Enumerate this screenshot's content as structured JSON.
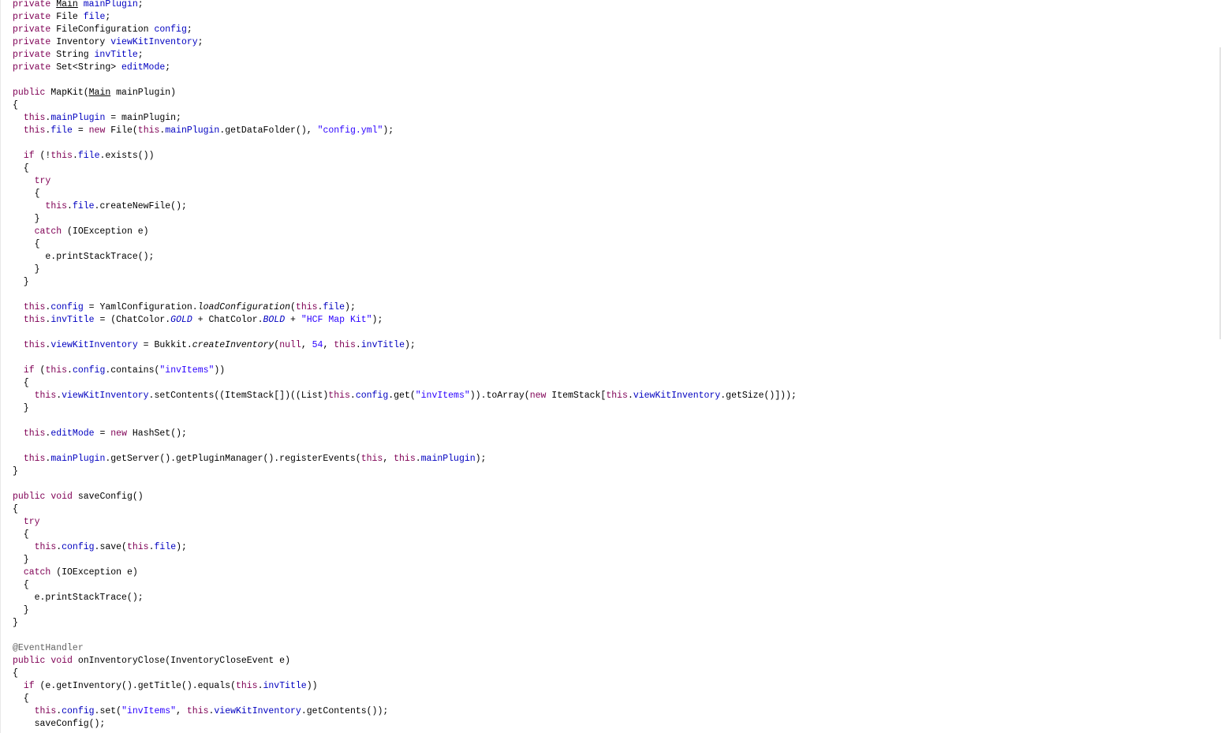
{
  "editor": {
    "language": "java",
    "colors": {
      "keyword": "#7f0055",
      "field": "#0000c0",
      "string": "#2a00ff",
      "number": "#2a00ff",
      "annotation": "#646464",
      "text": "#000000",
      "background": "#ffffff"
    },
    "lines": [
      [
        {
          "t": "kw",
          "v": "private"
        },
        {
          "v": " "
        },
        {
          "t": "ul",
          "v": "Main"
        },
        {
          "v": " "
        },
        {
          "t": "fld",
          "v": "mainPlugin"
        },
        {
          "v": ";"
        }
      ],
      [
        {
          "t": "kw",
          "v": "private"
        },
        {
          "v": " File "
        },
        {
          "t": "fld",
          "v": "file"
        },
        {
          "v": ";"
        }
      ],
      [
        {
          "t": "kw",
          "v": "private"
        },
        {
          "v": " FileConfiguration "
        },
        {
          "t": "fld",
          "v": "config"
        },
        {
          "v": ";"
        }
      ],
      [
        {
          "t": "kw",
          "v": "private"
        },
        {
          "v": " Inventory "
        },
        {
          "t": "fld",
          "v": "viewKitInventory"
        },
        {
          "v": ";"
        }
      ],
      [
        {
          "t": "kw",
          "v": "private"
        },
        {
          "v": " String "
        },
        {
          "t": "fld",
          "v": "invTitle"
        },
        {
          "v": ";"
        }
      ],
      [
        {
          "t": "kw",
          "v": "private"
        },
        {
          "v": " Set<String> "
        },
        {
          "t": "fld",
          "v": "editMode"
        },
        {
          "v": ";"
        }
      ],
      [],
      [
        {
          "t": "kw",
          "v": "public"
        },
        {
          "v": " MapKit("
        },
        {
          "t": "ul",
          "v": "Main"
        },
        {
          "v": " mainPlugin)"
        }
      ],
      [
        {
          "v": "{"
        }
      ],
      [
        {
          "v": "  "
        },
        {
          "t": "kw",
          "v": "this"
        },
        {
          "v": "."
        },
        {
          "t": "fld",
          "v": "mainPlugin"
        },
        {
          "v": " = mainPlugin;"
        }
      ],
      [
        {
          "v": "  "
        },
        {
          "t": "kw",
          "v": "this"
        },
        {
          "v": "."
        },
        {
          "t": "fld",
          "v": "file"
        },
        {
          "v": " = "
        },
        {
          "t": "kw",
          "v": "new"
        },
        {
          "v": " File("
        },
        {
          "t": "kw",
          "v": "this"
        },
        {
          "v": "."
        },
        {
          "t": "fld",
          "v": "mainPlugin"
        },
        {
          "v": ".getDataFolder(), "
        },
        {
          "t": "str",
          "v": "\"config.yml\""
        },
        {
          "v": ");"
        }
      ],
      [],
      [
        {
          "v": "  "
        },
        {
          "t": "kw",
          "v": "if"
        },
        {
          "v": " (!"
        },
        {
          "t": "kw",
          "v": "this"
        },
        {
          "v": "."
        },
        {
          "t": "fld",
          "v": "file"
        },
        {
          "v": ".exists())"
        }
      ],
      [
        {
          "v": "  {"
        }
      ],
      [
        {
          "v": "    "
        },
        {
          "t": "kw",
          "v": "try"
        }
      ],
      [
        {
          "v": "    {"
        }
      ],
      [
        {
          "v": "      "
        },
        {
          "t": "kw",
          "v": "this"
        },
        {
          "v": "."
        },
        {
          "t": "fld",
          "v": "file"
        },
        {
          "v": ".createNewFile();"
        }
      ],
      [
        {
          "v": "    }"
        }
      ],
      [
        {
          "v": "    "
        },
        {
          "t": "kw",
          "v": "catch"
        },
        {
          "v": " (IOException e)"
        }
      ],
      [
        {
          "v": "    {"
        }
      ],
      [
        {
          "v": "      e.printStackTrace();"
        }
      ],
      [
        {
          "v": "    }"
        }
      ],
      [
        {
          "v": "  }"
        }
      ],
      [],
      [
        {
          "v": "  "
        },
        {
          "t": "kw",
          "v": "this"
        },
        {
          "v": "."
        },
        {
          "t": "fld",
          "v": "config"
        },
        {
          "v": " = YamlConfiguration."
        },
        {
          "t": "it",
          "v": "loadConfiguration"
        },
        {
          "v": "("
        },
        {
          "t": "kw",
          "v": "this"
        },
        {
          "v": "."
        },
        {
          "t": "fld",
          "v": "file"
        },
        {
          "v": ");"
        }
      ],
      [
        {
          "v": "  "
        },
        {
          "t": "kw",
          "v": "this"
        },
        {
          "v": "."
        },
        {
          "t": "fld",
          "v": "invTitle"
        },
        {
          "v": " = (ChatColor."
        },
        {
          "t": "fldit",
          "v": "GOLD"
        },
        {
          "v": " + ChatColor."
        },
        {
          "t": "fldit",
          "v": "BOLD"
        },
        {
          "v": " + "
        },
        {
          "t": "str",
          "v": "\"HCF Map Kit\""
        },
        {
          "v": ");"
        }
      ],
      [],
      [
        {
          "v": "  "
        },
        {
          "t": "kw",
          "v": "this"
        },
        {
          "v": "."
        },
        {
          "t": "fld",
          "v": "viewKitInventory"
        },
        {
          "v": " = Bukkit."
        },
        {
          "t": "it",
          "v": "createInventory"
        },
        {
          "v": "("
        },
        {
          "t": "kw",
          "v": "null"
        },
        {
          "v": ", "
        },
        {
          "t": "num",
          "v": "54"
        },
        {
          "v": ", "
        },
        {
          "t": "kw",
          "v": "this"
        },
        {
          "v": "."
        },
        {
          "t": "fld",
          "v": "invTitle"
        },
        {
          "v": ");"
        }
      ],
      [],
      [
        {
          "v": "  "
        },
        {
          "t": "kw",
          "v": "if"
        },
        {
          "v": " ("
        },
        {
          "t": "kw",
          "v": "this"
        },
        {
          "v": "."
        },
        {
          "t": "fld",
          "v": "config"
        },
        {
          "v": ".contains("
        },
        {
          "t": "str",
          "v": "\"invItems\""
        },
        {
          "v": "))"
        }
      ],
      [
        {
          "v": "  {"
        }
      ],
      [
        {
          "v": "    "
        },
        {
          "t": "kw",
          "v": "this"
        },
        {
          "v": "."
        },
        {
          "t": "fld",
          "v": "viewKitInventory"
        },
        {
          "v": ".setContents((ItemStack[])((List)"
        },
        {
          "t": "kw",
          "v": "this"
        },
        {
          "v": "."
        },
        {
          "t": "fld",
          "v": "config"
        },
        {
          "v": ".get("
        },
        {
          "t": "str",
          "v": "\"invItems\""
        },
        {
          "v": ")).toArray("
        },
        {
          "t": "kw",
          "v": "new"
        },
        {
          "v": " ItemStack["
        },
        {
          "t": "kw",
          "v": "this"
        },
        {
          "v": "."
        },
        {
          "t": "fld",
          "v": "viewKitInventory"
        },
        {
          "v": ".getSize()]));"
        }
      ],
      [
        {
          "v": "  }"
        }
      ],
      [],
      [
        {
          "v": "  "
        },
        {
          "t": "kw",
          "v": "this"
        },
        {
          "v": "."
        },
        {
          "t": "fld",
          "v": "editMode"
        },
        {
          "v": " = "
        },
        {
          "t": "kw",
          "v": "new"
        },
        {
          "v": " HashSet();"
        }
      ],
      [],
      [
        {
          "v": "  "
        },
        {
          "t": "kw",
          "v": "this"
        },
        {
          "v": "."
        },
        {
          "t": "fld",
          "v": "mainPlugin"
        },
        {
          "v": ".getServer().getPluginManager().registerEvents("
        },
        {
          "t": "kw",
          "v": "this"
        },
        {
          "v": ", "
        },
        {
          "t": "kw",
          "v": "this"
        },
        {
          "v": "."
        },
        {
          "t": "fld",
          "v": "mainPlugin"
        },
        {
          "v": ");"
        }
      ],
      [
        {
          "v": "}"
        }
      ],
      [],
      [
        {
          "t": "kw",
          "v": "public"
        },
        {
          "v": " "
        },
        {
          "t": "kw",
          "v": "void"
        },
        {
          "v": " saveConfig()"
        }
      ],
      [
        {
          "v": "{"
        }
      ],
      [
        {
          "v": "  "
        },
        {
          "t": "kw",
          "v": "try"
        }
      ],
      [
        {
          "v": "  {"
        }
      ],
      [
        {
          "v": "    "
        },
        {
          "t": "kw",
          "v": "this"
        },
        {
          "v": "."
        },
        {
          "t": "fld",
          "v": "config"
        },
        {
          "v": ".save("
        },
        {
          "t": "kw",
          "v": "this"
        },
        {
          "v": "."
        },
        {
          "t": "fld",
          "v": "file"
        },
        {
          "v": ");"
        }
      ],
      [
        {
          "v": "  }"
        }
      ],
      [
        {
          "v": "  "
        },
        {
          "t": "kw",
          "v": "catch"
        },
        {
          "v": " (IOException e)"
        }
      ],
      [
        {
          "v": "  {"
        }
      ],
      [
        {
          "v": "    e.printStackTrace();"
        }
      ],
      [
        {
          "v": "  }"
        }
      ],
      [
        {
          "v": "}"
        }
      ],
      [],
      [
        {
          "t": "ann",
          "v": "@EventHandler"
        }
      ],
      [
        {
          "t": "kw",
          "v": "public"
        },
        {
          "v": " "
        },
        {
          "t": "kw",
          "v": "void"
        },
        {
          "v": " onInventoryClose(InventoryCloseEvent e)"
        }
      ],
      [
        {
          "v": "{"
        }
      ],
      [
        {
          "v": "  "
        },
        {
          "t": "kw",
          "v": "if"
        },
        {
          "v": " (e.getInventory().getTitle().equals("
        },
        {
          "t": "kw",
          "v": "this"
        },
        {
          "v": "."
        },
        {
          "t": "fld",
          "v": "invTitle"
        },
        {
          "v": "))"
        }
      ],
      [
        {
          "v": "  {"
        }
      ],
      [
        {
          "v": "    "
        },
        {
          "t": "kw",
          "v": "this"
        },
        {
          "v": "."
        },
        {
          "t": "fld",
          "v": "config"
        },
        {
          "v": ".set("
        },
        {
          "t": "str",
          "v": "\"invItems\""
        },
        {
          "v": ", "
        },
        {
          "t": "kw",
          "v": "this"
        },
        {
          "v": "."
        },
        {
          "t": "fld",
          "v": "viewKitInventory"
        },
        {
          "v": ".getContents());"
        }
      ],
      [
        {
          "v": "    saveConfig();"
        }
      ]
    ]
  }
}
